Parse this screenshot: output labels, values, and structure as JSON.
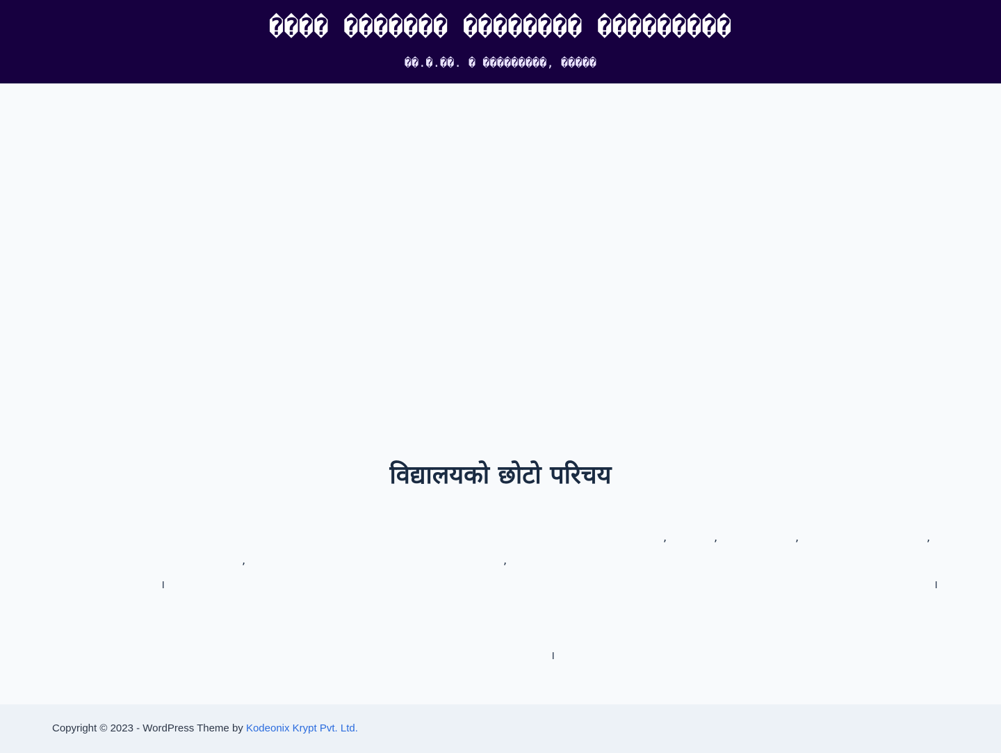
{
  "header": {
    "site_title": "���� ������� �������� ���������",
    "tagline": "��.�.��. � ���������, �����"
  },
  "about": {
    "heading": "विद्यालयको छोटो परिचय",
    "punctuation": {
      "line1": [
        ",",
        ",",
        ",",
        ","
      ],
      "line2": [
        ",",
        ","
      ],
      "line3": [
        "।",
        "।"
      ],
      "line4": [
        "।"
      ]
    }
  },
  "footer": {
    "copyright": "Copyright © 2023 - WordPress Theme by ",
    "link_text": "Kodeonix Krypt Pvt. Ltd."
  },
  "colors": {
    "header_bg": "#170040",
    "page_bg": "#f8fafc",
    "heading_text": "#1a2b42",
    "footer_bg": "#edf2f7",
    "link": "#2b6cde"
  }
}
